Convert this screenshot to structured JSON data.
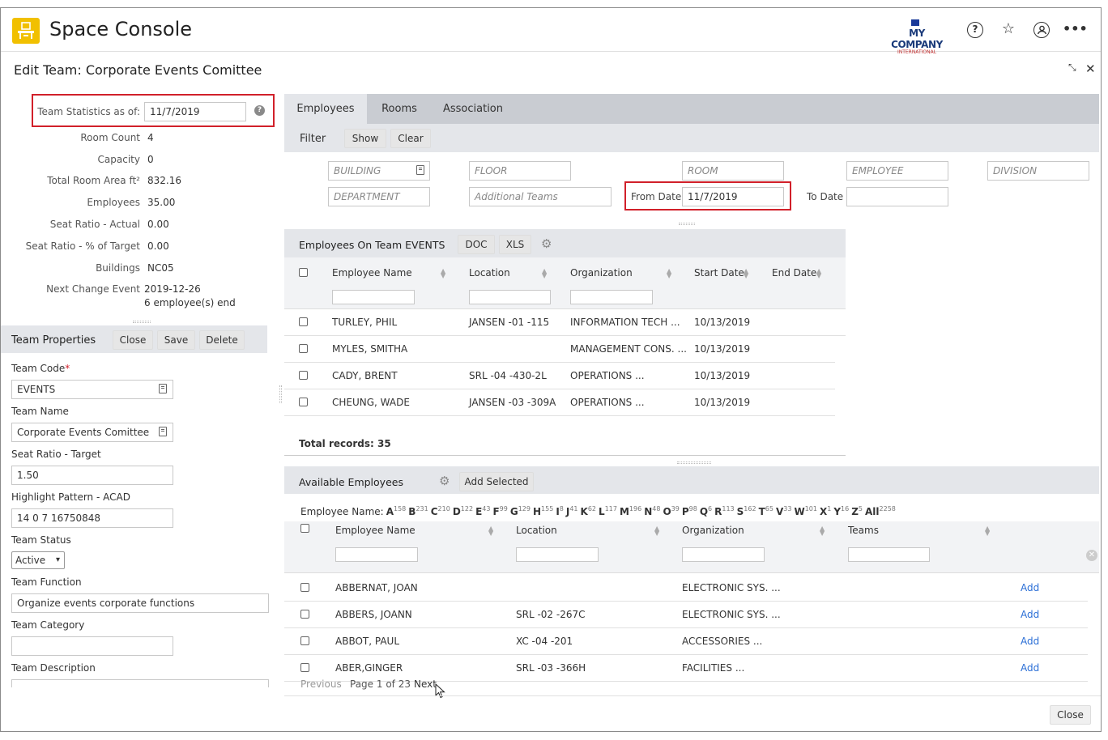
{
  "app": {
    "title": "Space Console",
    "company_line1": "MY COMPANY",
    "company_line2": "INTERNATIONAL"
  },
  "page": {
    "title": "Edit Team: Corporate Events Comittee"
  },
  "stats": {
    "as_of_label": "Team Statistics as of:",
    "as_of_value": "11/7/2019",
    "items": [
      {
        "label": "Room Count",
        "value": "4"
      },
      {
        "label": "Capacity",
        "value": "0"
      },
      {
        "label": "Total Room Area ft²",
        "value": "832.16"
      },
      {
        "label": "Employees",
        "value": "35.00"
      },
      {
        "label": "Seat Ratio - Actual",
        "value": "0.00"
      },
      {
        "label": "Seat Ratio - % of Target",
        "value": "0.00"
      },
      {
        "label": "Buildings",
        "value": "NC05"
      },
      {
        "label": "Next Change Event",
        "value": "2019-12-26",
        "value2": "6 employee(s) end"
      }
    ]
  },
  "props": {
    "title": "Team Properties",
    "close": "Close",
    "save": "Save",
    "delete": "Delete",
    "code_label": "Team Code",
    "code_required": "*",
    "code_value": "EVENTS",
    "name_label": "Team Name",
    "name_value": "Corporate Events Comittee",
    "seat_label": "Seat Ratio - Target",
    "seat_value": "1.50",
    "pattern_label": "Highlight Pattern - ACAD",
    "pattern_value": "14 0 7 16750848",
    "status_label": "Team Status",
    "status_value": "Active",
    "function_label": "Team Function",
    "function_value": "Organize events corporate functions",
    "category_label": "Team Category",
    "category_value": "",
    "desc_label": "Team Description"
  },
  "tabs": [
    {
      "label": "Employees"
    },
    {
      "label": "Rooms"
    },
    {
      "label": "Association"
    }
  ],
  "filter": {
    "label": "Filter",
    "show": "Show",
    "clear": "Clear",
    "building": "BUILDING",
    "floor": "FLOOR",
    "room": "ROOM",
    "employee": "EMPLOYEE",
    "division": "DIVISION",
    "department": "DEPARTMENT",
    "additional": "Additional Teams",
    "from_label": "From Date",
    "from_value": "11/7/2019",
    "to_label": "To Date",
    "to_value": ""
  },
  "team_emps": {
    "title": "Employees On Team EVENTS",
    "doc": "DOC",
    "xls": "XLS",
    "columns": [
      "Employee Name",
      "Location",
      "Organization",
      "Start Date",
      "End Date"
    ],
    "rows": [
      [
        "TURLEY, PHIL",
        "JANSEN -01 -115",
        "INFORMATION TECH ...",
        "10/13/2019",
        ""
      ],
      [
        "MYLES, SMITHA",
        "",
        "MANAGEMENT CONS. ...",
        "10/13/2019",
        ""
      ],
      [
        "CADY, BRENT",
        "SRL -04 -430-2L",
        "OPERATIONS ...",
        "10/13/2019",
        ""
      ],
      [
        "CHEUNG, WADE",
        "JANSEN -03 -309A",
        "OPERATIONS ...",
        "10/13/2019",
        ""
      ]
    ],
    "total": "Total records: 35"
  },
  "avail": {
    "title": "Available Employees",
    "add_selected": "Add Selected",
    "name_filter_label": "Employee Name:",
    "letters": [
      [
        "A",
        "158"
      ],
      [
        "B",
        "231"
      ],
      [
        "C",
        "210"
      ],
      [
        "D",
        "122"
      ],
      [
        "E",
        "43"
      ],
      [
        "F",
        "99"
      ],
      [
        "G",
        "129"
      ],
      [
        "H",
        "155"
      ],
      [
        "I",
        "8"
      ],
      [
        "J",
        "41"
      ],
      [
        "K",
        "62"
      ],
      [
        "L",
        "117"
      ],
      [
        "M",
        "196"
      ],
      [
        "N",
        "48"
      ],
      [
        "O",
        "39"
      ],
      [
        "P",
        "98"
      ],
      [
        "Q",
        "6"
      ],
      [
        "R",
        "113"
      ],
      [
        "S",
        "162"
      ],
      [
        "T",
        "65"
      ],
      [
        "V",
        "33"
      ],
      [
        "W",
        "101"
      ],
      [
        "X",
        "1"
      ],
      [
        "Y",
        "16"
      ],
      [
        "Z",
        "5"
      ],
      [
        "All",
        "2258"
      ]
    ],
    "columns": [
      "Employee Name",
      "Location",
      "Organization",
      "Teams"
    ],
    "rows": [
      [
        "ABBERNAT, JOAN",
        "",
        "ELECTRONIC SYS. ...",
        "",
        "Add"
      ],
      [
        "ABBERS, JOANN",
        "SRL -02 -267C",
        "ELECTRONIC SYS. ...",
        "",
        "Add"
      ],
      [
        "ABBOT, PAUL",
        "XC -04 -201",
        "ACCESSORIES ...",
        "",
        "Add"
      ],
      [
        "ABER,GINGER",
        "SRL -03 -366H",
        "FACILITIES ...",
        "",
        "Add"
      ]
    ],
    "prev": "Previous",
    "page": "Page 1 of 23",
    "next": "Next"
  },
  "footer": {
    "close": "Close"
  }
}
